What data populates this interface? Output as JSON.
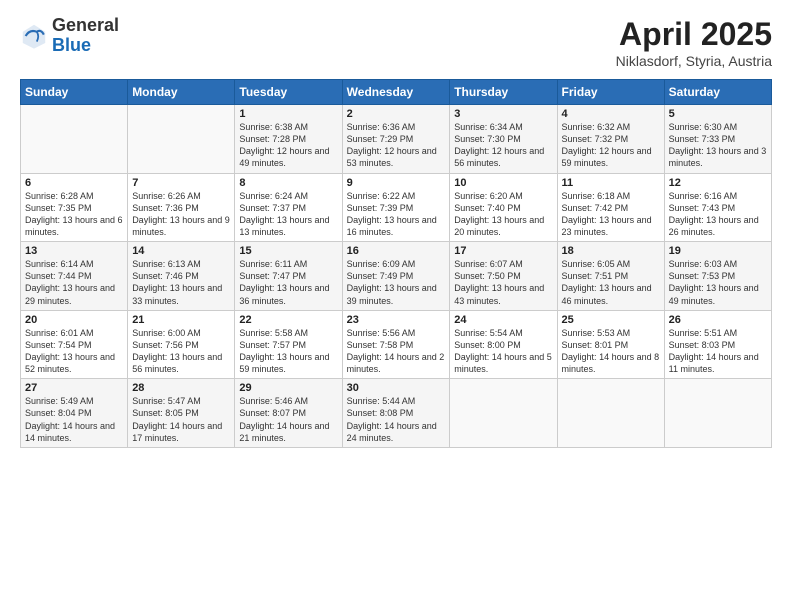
{
  "header": {
    "logo_general": "General",
    "logo_blue": "Blue",
    "month": "April 2025",
    "location": "Niklasdorf, Styria, Austria"
  },
  "weekdays": [
    "Sunday",
    "Monday",
    "Tuesday",
    "Wednesday",
    "Thursday",
    "Friday",
    "Saturday"
  ],
  "weeks": [
    [
      {
        "day": "",
        "info": ""
      },
      {
        "day": "",
        "info": ""
      },
      {
        "day": "1",
        "info": "Sunrise: 6:38 AM\nSunset: 7:28 PM\nDaylight: 12 hours and 49 minutes."
      },
      {
        "day": "2",
        "info": "Sunrise: 6:36 AM\nSunset: 7:29 PM\nDaylight: 12 hours and 53 minutes."
      },
      {
        "day": "3",
        "info": "Sunrise: 6:34 AM\nSunset: 7:30 PM\nDaylight: 12 hours and 56 minutes."
      },
      {
        "day": "4",
        "info": "Sunrise: 6:32 AM\nSunset: 7:32 PM\nDaylight: 12 hours and 59 minutes."
      },
      {
        "day": "5",
        "info": "Sunrise: 6:30 AM\nSunset: 7:33 PM\nDaylight: 13 hours and 3 minutes."
      }
    ],
    [
      {
        "day": "6",
        "info": "Sunrise: 6:28 AM\nSunset: 7:35 PM\nDaylight: 13 hours and 6 minutes."
      },
      {
        "day": "7",
        "info": "Sunrise: 6:26 AM\nSunset: 7:36 PM\nDaylight: 13 hours and 9 minutes."
      },
      {
        "day": "8",
        "info": "Sunrise: 6:24 AM\nSunset: 7:37 PM\nDaylight: 13 hours and 13 minutes."
      },
      {
        "day": "9",
        "info": "Sunrise: 6:22 AM\nSunset: 7:39 PM\nDaylight: 13 hours and 16 minutes."
      },
      {
        "day": "10",
        "info": "Sunrise: 6:20 AM\nSunset: 7:40 PM\nDaylight: 13 hours and 20 minutes."
      },
      {
        "day": "11",
        "info": "Sunrise: 6:18 AM\nSunset: 7:42 PM\nDaylight: 13 hours and 23 minutes."
      },
      {
        "day": "12",
        "info": "Sunrise: 6:16 AM\nSunset: 7:43 PM\nDaylight: 13 hours and 26 minutes."
      }
    ],
    [
      {
        "day": "13",
        "info": "Sunrise: 6:14 AM\nSunset: 7:44 PM\nDaylight: 13 hours and 29 minutes."
      },
      {
        "day": "14",
        "info": "Sunrise: 6:13 AM\nSunset: 7:46 PM\nDaylight: 13 hours and 33 minutes."
      },
      {
        "day": "15",
        "info": "Sunrise: 6:11 AM\nSunset: 7:47 PM\nDaylight: 13 hours and 36 minutes."
      },
      {
        "day": "16",
        "info": "Sunrise: 6:09 AM\nSunset: 7:49 PM\nDaylight: 13 hours and 39 minutes."
      },
      {
        "day": "17",
        "info": "Sunrise: 6:07 AM\nSunset: 7:50 PM\nDaylight: 13 hours and 43 minutes."
      },
      {
        "day": "18",
        "info": "Sunrise: 6:05 AM\nSunset: 7:51 PM\nDaylight: 13 hours and 46 minutes."
      },
      {
        "day": "19",
        "info": "Sunrise: 6:03 AM\nSunset: 7:53 PM\nDaylight: 13 hours and 49 minutes."
      }
    ],
    [
      {
        "day": "20",
        "info": "Sunrise: 6:01 AM\nSunset: 7:54 PM\nDaylight: 13 hours and 52 minutes."
      },
      {
        "day": "21",
        "info": "Sunrise: 6:00 AM\nSunset: 7:56 PM\nDaylight: 13 hours and 56 minutes."
      },
      {
        "day": "22",
        "info": "Sunrise: 5:58 AM\nSunset: 7:57 PM\nDaylight: 13 hours and 59 minutes."
      },
      {
        "day": "23",
        "info": "Sunrise: 5:56 AM\nSunset: 7:58 PM\nDaylight: 14 hours and 2 minutes."
      },
      {
        "day": "24",
        "info": "Sunrise: 5:54 AM\nSunset: 8:00 PM\nDaylight: 14 hours and 5 minutes."
      },
      {
        "day": "25",
        "info": "Sunrise: 5:53 AM\nSunset: 8:01 PM\nDaylight: 14 hours and 8 minutes."
      },
      {
        "day": "26",
        "info": "Sunrise: 5:51 AM\nSunset: 8:03 PM\nDaylight: 14 hours and 11 minutes."
      }
    ],
    [
      {
        "day": "27",
        "info": "Sunrise: 5:49 AM\nSunset: 8:04 PM\nDaylight: 14 hours and 14 minutes."
      },
      {
        "day": "28",
        "info": "Sunrise: 5:47 AM\nSunset: 8:05 PM\nDaylight: 14 hours and 17 minutes."
      },
      {
        "day": "29",
        "info": "Sunrise: 5:46 AM\nSunset: 8:07 PM\nDaylight: 14 hours and 21 minutes."
      },
      {
        "day": "30",
        "info": "Sunrise: 5:44 AM\nSunset: 8:08 PM\nDaylight: 14 hours and 24 minutes."
      },
      {
        "day": "",
        "info": ""
      },
      {
        "day": "",
        "info": ""
      },
      {
        "day": "",
        "info": ""
      }
    ]
  ]
}
